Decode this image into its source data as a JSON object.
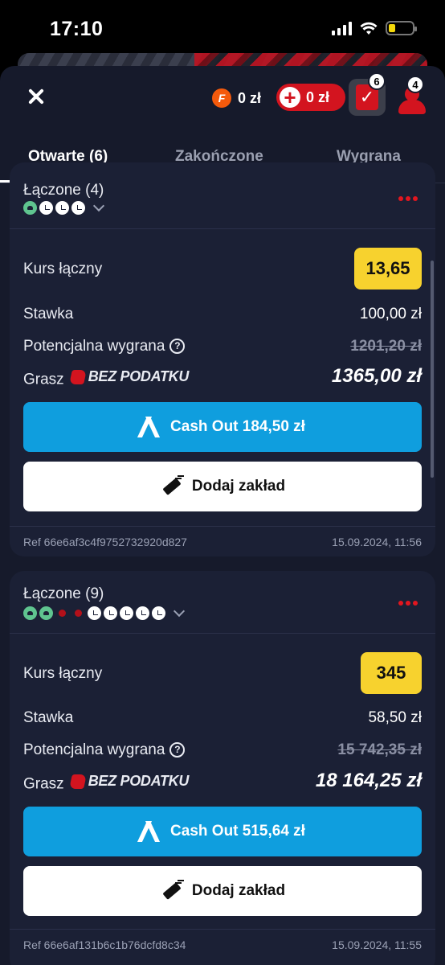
{
  "status_bar": {
    "time": "17:10",
    "battery_level": 0.28
  },
  "header": {
    "f_balance": "0 zł",
    "f_icon_letter": "F",
    "plus_balance": "0 zł",
    "betslip_count": "6",
    "profile_count": "4"
  },
  "tabs": [
    {
      "label": "Otwarte (6)",
      "active": true
    },
    {
      "label": "Zakończone",
      "active": false
    },
    {
      "label": "Wygrana",
      "active": false
    }
  ],
  "bets": [
    {
      "title": "Łączone (4)",
      "legs": [
        "won",
        "pending",
        "pending",
        "pending"
      ],
      "total_odds_label": "Kurs łączny",
      "total_odds": "13,65",
      "stake_label": "Stawka",
      "stake": "100,00 zł",
      "potential_label": "Potencjalna wygrana",
      "potential_old": "1201,20 zł",
      "tax_free_label": "Grasz",
      "tax_free_brand": "BEZ PODATKU",
      "potential_win": "1365,00 zł",
      "cashout_label": "Cash Out 184,50 zł",
      "add_bet_label": "Dodaj zakład",
      "ref": "Ref 66e6af3c4f9752732920d827",
      "date": "15.09.2024, 11:56"
    },
    {
      "title": "Łączone (9)",
      "legs": [
        "won",
        "won",
        "lost",
        "lost",
        "pending",
        "pending",
        "pending",
        "pending",
        "pending"
      ],
      "total_odds_label": "Kurs łączny",
      "total_odds": "345",
      "stake_label": "Stawka",
      "stake": "58,50 zł",
      "potential_label": "Potencjalna wygrana",
      "potential_old": "15 742,35 zł",
      "tax_free_label": "Grasz",
      "tax_free_brand": "BEZ PODATKU",
      "potential_win": "18 164,25 zł",
      "cashout_label": "Cash Out 515,64 zł",
      "add_bet_label": "Dodaj zakład",
      "ref": "Ref 66e6af131b6c1b76dcfd8c34",
      "date": "15.09.2024, 11:55"
    }
  ],
  "colors": {
    "accent_red": "#d3141f",
    "cashout_blue": "#0f9ede",
    "odds_yellow": "#f7d22e",
    "won_green": "#5fc48f",
    "sheet_bg": "#161a2b",
    "card_bg": "#1b2035"
  }
}
